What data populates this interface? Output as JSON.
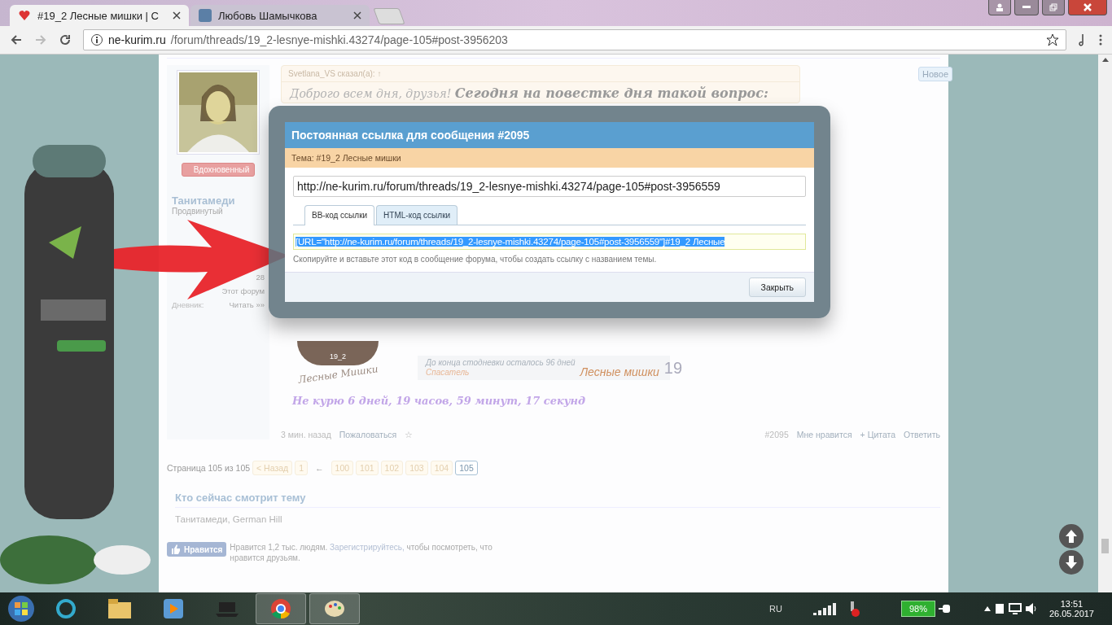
{
  "browser": {
    "tabs": [
      {
        "title": "#19_2 Лесные мишки | С",
        "selected": true
      },
      {
        "title": "Любовь Шамычкова",
        "selected": false
      }
    ],
    "address_host": "ne-kurim.ru",
    "address_path": "/forum/threads/19_2-lesnye-mishki.43274/page-105#post-3956203"
  },
  "new_badge": "Новое",
  "post": {
    "author": "Танитамеди",
    "rank": "Продвинутый",
    "badge": "Вдохновенный",
    "stats": [
      {
        "value": "28"
      },
      {
        "value": "Этот форум"
      },
      {
        "label": "Дневник:",
        "value": "Читать »»"
      }
    ],
    "quote_author": "Svetlana_VS сказал(а): ↑",
    "message": "Доброго всем дня, друзья! **Сегодня на повестке дня такой вопрос:**",
    "logo": {
      "number": "19_2",
      "name": "Лесные Мишки"
    },
    "banner": {
      "line1": "До конца стодневки осталось 96 дней",
      "line2": "Спасатель",
      "title": "Лесные мишки",
      "number": "19"
    },
    "smoke_free": "Не курю  6 дней, 19 часов, 59 минут, 17 секунд",
    "time": "3 мин. назад",
    "report": "Пожаловаться",
    "star": "☆",
    "number": "#2095",
    "actions": [
      "Мне нравится",
      "+ Цитата",
      "Ответить"
    ]
  },
  "pagination": {
    "label": "Страница 105 из 105",
    "prev": "< Назад",
    "first": "1",
    "gap": "←",
    "pages": [
      {
        "label": "100",
        "selected": false
      },
      {
        "label": "101",
        "selected": false
      },
      {
        "label": "102",
        "selected": false
      },
      {
        "label": "103",
        "selected": false
      },
      {
        "label": "104",
        "selected": false
      },
      {
        "label": "105",
        "selected": true
      }
    ]
  },
  "viewers": {
    "title": "Кто сейчас смотрит тему",
    "names": "Танитамеди, German Hill"
  },
  "facebook": {
    "button": "Нравится",
    "count": "Нравится 1,2 тыс. людям.",
    "link": "Зарегистрируйтесь,",
    "rest": "чтобы посмотреть, что нравится друзьям."
  },
  "dialog": {
    "title": "Постоянная ссылка для сообщения #2095",
    "topic": "Тема: #19_2 Лесные мишки",
    "url": "http://ne-kurim.ru/forum/threads/19_2-lesnye-mishki.43274/page-105#post-3956559",
    "tabs": [
      {
        "label": "BB-код ссылки",
        "selected": true
      },
      {
        "label": "HTML-код ссылки",
        "selected": false
      }
    ],
    "code": "[URL=\"http://ne-kurim.ru/forum/threads/19_2-lesnye-mishki.43274/page-105#post-3956559\"]#19_2 Лесные",
    "code_selected": true,
    "hint": "Скопируйте и вставьте этот код в сообщение форума, чтобы создать ссылку с названием темы.",
    "close": "Закрыть"
  },
  "taskbar": {
    "language": "RU",
    "battery": "98%",
    "time": "13:51",
    "date": "26.05.2017"
  }
}
